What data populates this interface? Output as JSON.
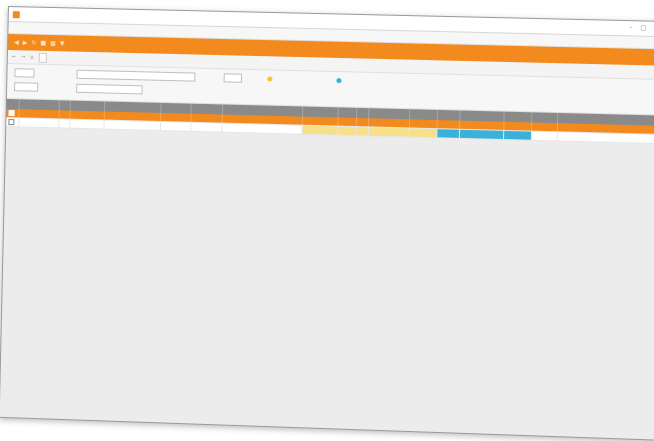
{
  "titlebar": {
    "title": "",
    "icons": [
      "minimize-icon",
      "maximize-icon",
      "close-icon"
    ]
  },
  "menu": [
    {
      "label": ""
    },
    {
      "label": ""
    },
    {
      "label": ""
    },
    {
      "label": ""
    }
  ],
  "ribbon": {
    "icons": [
      "arrow-left-icon",
      "arrow-right-icon",
      "refresh-icon",
      "save-icon",
      "print-icon",
      "filter-icon"
    ],
    "label": ""
  },
  "toolbar": {
    "icons": [
      "back-icon",
      "forward-icon",
      "home-icon"
    ],
    "button_label": "",
    "label": ""
  },
  "filters": {
    "field1": {
      "label": "",
      "value": ""
    },
    "field2": {
      "label": "",
      "value": ""
    },
    "field3": {
      "label": "",
      "value": ""
    },
    "field4": {
      "label": "",
      "value": ""
    },
    "field5": {
      "label": "",
      "value": ""
    }
  },
  "legend": [
    {
      "label": "",
      "color": "#f2c230"
    },
    {
      "label": "",
      "color": "#39b1d9"
    }
  ],
  "colors": {
    "accent": "#f28a1e",
    "yellow": "#f7e08a",
    "blue": "#39b1d9"
  },
  "table": {
    "columns": [
      "",
      "",
      "",
      "",
      "",
      "",
      "",
      "",
      "",
      "",
      "",
      "",
      "",
      "",
      "",
      "",
      "",
      ""
    ],
    "rows": [
      {
        "selected": true,
        "cells": [
          "",
          "",
          "",
          "",
          "",
          "",
          "",
          "",
          "",
          "",
          "",
          "",
          "",
          "",
          "",
          "",
          "",
          ""
        ]
      },
      {
        "selected": false,
        "cells": [
          "",
          "",
          "",
          "",
          "",
          "",
          "",
          "",
          "",
          "",
          "",
          "",
          "",
          "",
          "",
          "",
          "",
          ""
        ]
      }
    ]
  }
}
